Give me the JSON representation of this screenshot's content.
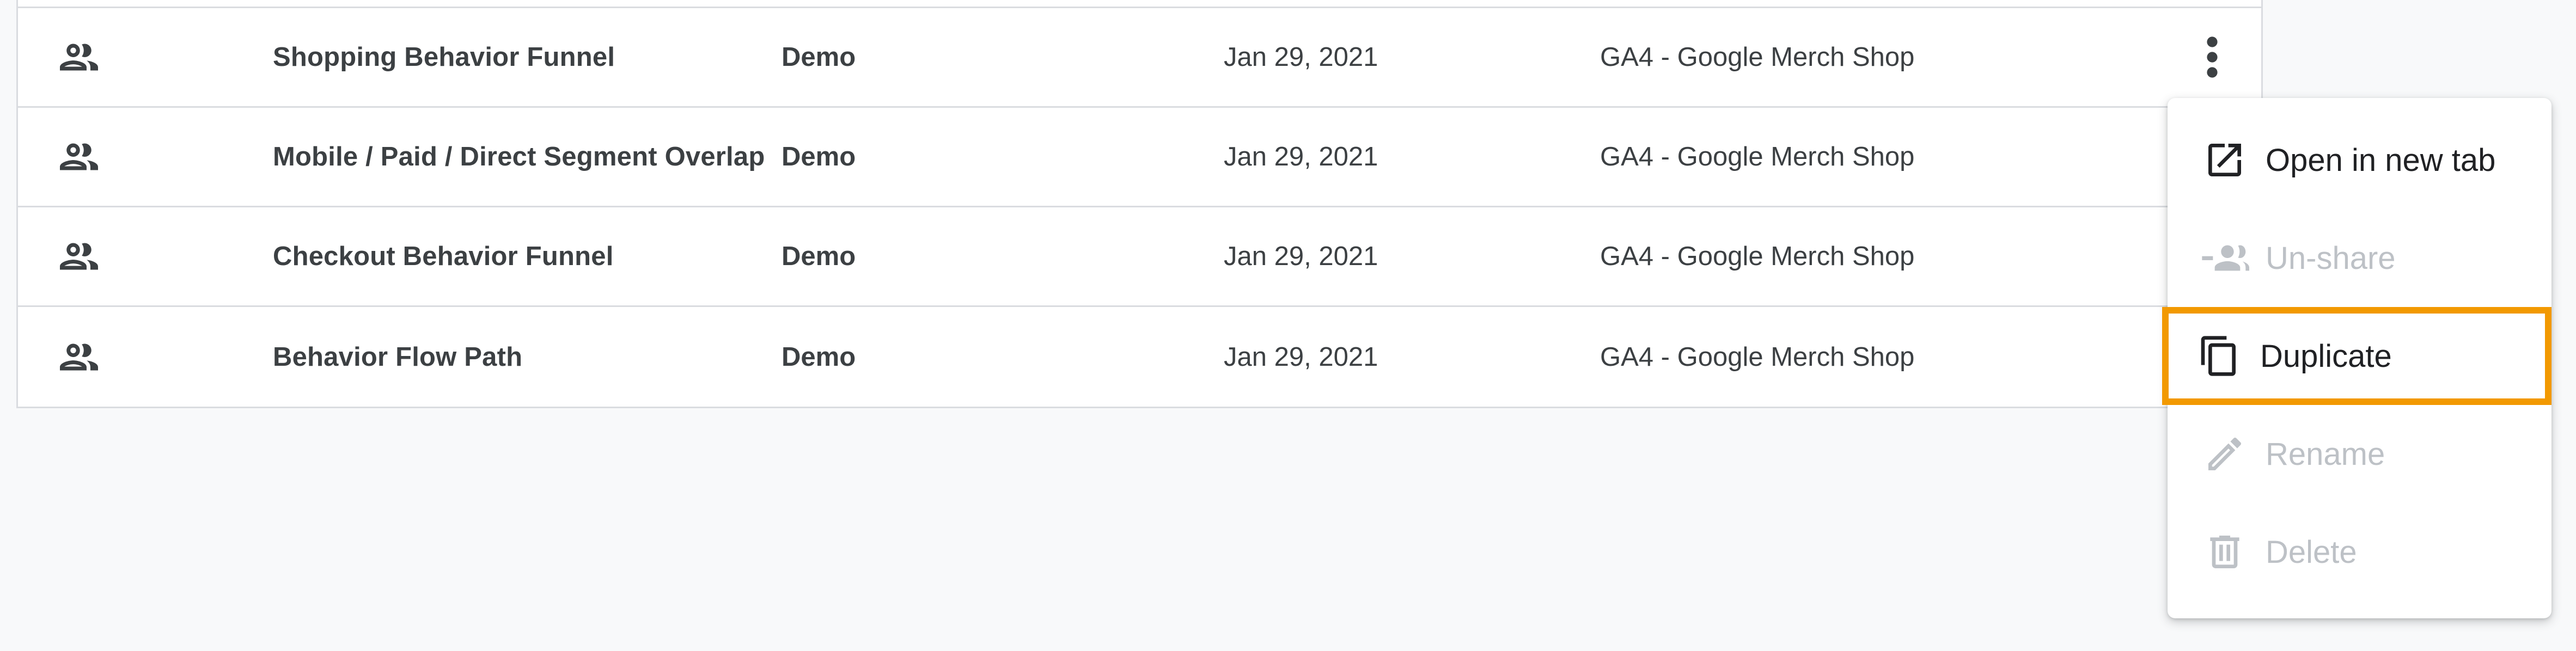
{
  "table": {
    "rows": [
      {
        "name": "Shopping Behavior Funnel",
        "type": "Demo",
        "date": "Jan 29, 2021",
        "property": "GA4 - Google Merch Shop"
      },
      {
        "name": "Mobile / Paid / Direct Segment Overlap",
        "type": "Demo",
        "date": "Jan 29, 2021",
        "property": "GA4 - Google Merch Shop"
      },
      {
        "name": "Checkout Behavior Funnel",
        "type": "Demo",
        "date": "Jan 29, 2021",
        "property": "GA4 - Google Merch Shop"
      },
      {
        "name": "Behavior Flow Path",
        "type": "Demo",
        "date": "Jan 29, 2021",
        "property": "GA4 - Google Merch Shop"
      }
    ],
    "row_icon": "people-icon",
    "menu_icon": "more-vert-icon"
  },
  "context_menu": {
    "items": [
      {
        "label": "Open in new tab",
        "icon": "open-in-new-icon",
        "enabled": true
      },
      {
        "label": "Un-share",
        "icon": "unshare-icon",
        "enabled": false
      },
      {
        "label": "Duplicate",
        "icon": "duplicate-icon",
        "enabled": true,
        "highlighted": true
      },
      {
        "label": "Rename",
        "icon": "edit-icon",
        "enabled": false
      },
      {
        "label": "Delete",
        "icon": "delete-icon",
        "enabled": false
      }
    ]
  },
  "colors": {
    "highlight": "#f29900",
    "text": "#3c4043",
    "disabled": "#bdc1c6",
    "border": "#dadce0",
    "background": "#f8f9fa"
  }
}
